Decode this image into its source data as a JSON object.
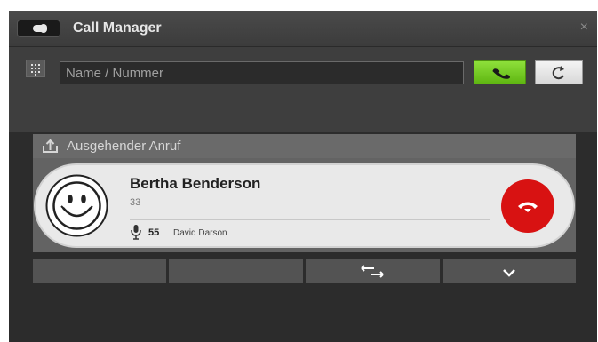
{
  "window": {
    "title": "Call Manager",
    "close_label": "×"
  },
  "search": {
    "placeholder": "Name / Nummer",
    "value": ""
  },
  "panel": {
    "header_label": "Ausgehender Anruf"
  },
  "call": {
    "caller_name": "Bertha Benderson",
    "caller_number": "33",
    "extension_number": "55",
    "extension_name": "David Darson"
  },
  "icons": {
    "toggle": "toggle-icon",
    "keypad": "dialpad-icon",
    "call": "phone-call-icon",
    "refresh": "refresh-icon",
    "outgoing": "outgoing-call-icon",
    "avatar": "smiley-avatar",
    "mic": "microphone-icon",
    "hangup": "hang-up-icon",
    "transfer": "transfer-icon",
    "more": "chevron-down-icon"
  },
  "colors": {
    "window_bg": "#3a3a3a",
    "call_button": "#6cc520",
    "hangup_button": "#d81212",
    "card_bg": "#e9e9e9"
  }
}
